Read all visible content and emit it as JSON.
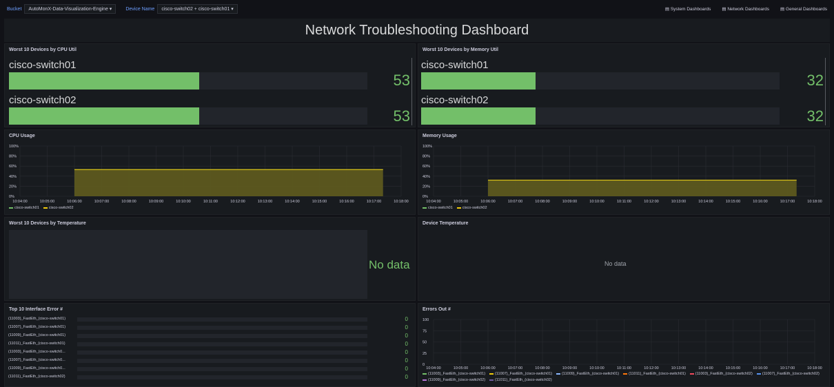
{
  "topbar": {
    "bucket_label": "Bucket",
    "bucket_value": "AutoMonX-Data-Visualization-Engine",
    "device_label": "Device Name",
    "device_value": "cisco-switch02 + cisco-switch01",
    "links": [
      "System Dashboards",
      "Network Dashboards",
      "General Dashboards"
    ]
  },
  "dashboard_title": "Network Troubleshooting Dashboard",
  "cpu_panel": {
    "title": "Worst 10 Devices by CPU Util",
    "rows": [
      {
        "name": "cisco-switch01",
        "value": "53",
        "fraction": 0.53
      },
      {
        "name": "cisco-switch02",
        "value": "53",
        "fraction": 0.53
      }
    ]
  },
  "mem_panel": {
    "title": "Worst 10 Devices by Memory Util",
    "rows": [
      {
        "name": "cisco-switch01",
        "value": "32",
        "fraction": 0.32
      },
      {
        "name": "cisco-switch02",
        "value": "32",
        "fraction": 0.32
      }
    ]
  },
  "cpu_usage": {
    "title": "CPU Usage",
    "legend": [
      "cisco-switch01",
      "cisco-switch02"
    ]
  },
  "mem_usage": {
    "title": "Memory Usage",
    "legend": [
      "cisco-switch01",
      "cisco-switch02"
    ]
  },
  "temp_panel": {
    "title": "Worst 10 Devices by Temperature",
    "nodata": "No data"
  },
  "device_temp": {
    "title": "Device Temperature",
    "nodata": "No data"
  },
  "err_panel": {
    "title": "Top 10 Interface Error #",
    "rows": [
      {
        "label": "(11003)_FastEth_(cisco-switch01)",
        "value": "0"
      },
      {
        "label": "(11007)_FastEth_(cisco-switch01)",
        "value": "0"
      },
      {
        "label": "(11009)_FastEth_(cisco-switch01)",
        "value": "0"
      },
      {
        "label": "(11011)_FastEth_(cisco-switch01)",
        "value": "0"
      },
      {
        "label": "(11003)_FastEth_(cisco-switch0...",
        "value": "0"
      },
      {
        "label": "(11007)_FastEth_(cisco-switch0...",
        "value": "0"
      },
      {
        "label": "(11009)_FastEth_(cisco-switch0...",
        "value": "0"
      },
      {
        "label": "(11011)_FastEth_(cisco-switch02)",
        "value": "0"
      }
    ]
  },
  "errors_out": {
    "title": "Errors Out #",
    "legend": [
      {
        "name": "(11003)_FastEth_(cisco-switch01)",
        "color": "#73bf69"
      },
      {
        "name": "(11007)_FastEth_(cisco-switch01)",
        "color": "#f2cc0c"
      },
      {
        "name": "(11009)_FastEth_(cisco-switch01)",
        "color": "#8ab8ff"
      },
      {
        "name": "(11011)_FastEth_(cisco-switch01)",
        "color": "#ff780a"
      },
      {
        "name": "(11003)_FastEth_(cisco-switch02)",
        "color": "#f2495c"
      },
      {
        "name": "(11007)_FastEth_(cisco-switch02)",
        "color": "#5794f2"
      },
      {
        "name": "(11009)_FastEth_(cisco-switch02)",
        "color": "#b877d9"
      },
      {
        "name": "(11011)_FastEth_(cisco-switch02)",
        "color": "#705da0"
      }
    ]
  },
  "chart_data": [
    {
      "type": "area",
      "title": "CPU Usage",
      "x": [
        "10:04:00",
        "10:05:00",
        "10:06:00",
        "10:07:00",
        "10:08:00",
        "10:09:00",
        "10:10:00",
        "10:11:00",
        "10:12:00",
        "10:13:00",
        "10:14:00",
        "10:15:00",
        "10:16:00",
        "10:17:00",
        "10:18:00"
      ],
      "yticks": [
        "0%",
        "20%",
        "40%",
        "60%",
        "80%",
        "100%"
      ],
      "ylim": [
        0,
        100
      ],
      "series": [
        {
          "name": "cisco-switch01",
          "color": "#73bf69",
          "start": "10:06:00",
          "end": "10:17:20",
          "value": 53
        },
        {
          "name": "cisco-switch02",
          "color": "#f2cc0c",
          "start": "10:06:00",
          "end": "10:17:20",
          "value": 53
        }
      ]
    },
    {
      "type": "area",
      "title": "Memory Usage",
      "x": [
        "10:04:00",
        "10:05:00",
        "10:06:00",
        "10:07:00",
        "10:08:00",
        "10:09:00",
        "10:10:00",
        "10:11:00",
        "10:12:00",
        "10:13:00",
        "10:14:00",
        "10:15:00",
        "10:16:00",
        "10:17:00",
        "10:18:00"
      ],
      "yticks": [
        "0%",
        "20%",
        "40%",
        "60%",
        "80%",
        "100%"
      ],
      "ylim": [
        0,
        100
      ],
      "series": [
        {
          "name": "cisco-switch01",
          "color": "#73bf69",
          "start": "10:06:00",
          "end": "10:17:20",
          "value": 32
        },
        {
          "name": "cisco-switch02",
          "color": "#f2cc0c",
          "start": "10:06:00",
          "end": "10:17:20",
          "value": 32
        }
      ]
    },
    {
      "type": "line",
      "title": "Errors Out #",
      "x": [
        "10:04:00",
        "10:05:00",
        "10:06:00",
        "10:07:00",
        "10:08:00",
        "10:09:00",
        "10:10:00",
        "10:11:00",
        "10:12:00",
        "10:13:00",
        "10:14:00",
        "10:15:00",
        "10:16:00",
        "10:17:00",
        "10:18:00"
      ],
      "yticks": [
        "0",
        "25",
        "50",
        "75",
        "100"
      ],
      "ylim": [
        0,
        100
      ],
      "series": []
    }
  ]
}
